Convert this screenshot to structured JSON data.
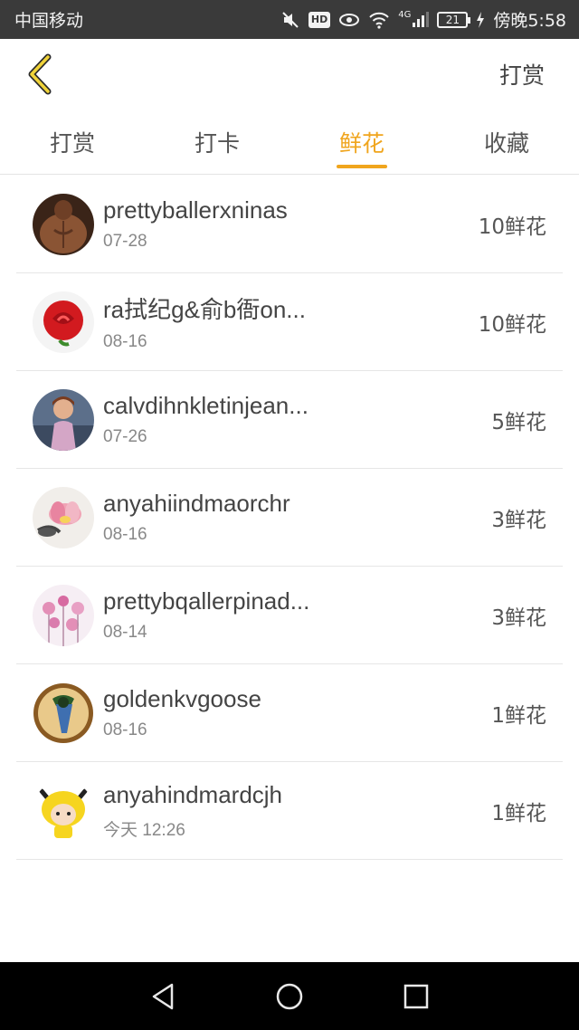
{
  "status_bar": {
    "carrier": "中国移动",
    "network": "4G",
    "battery": "21",
    "time": "傍晚5:58",
    "hd_badge": "HD"
  },
  "header": {
    "back_icon": "chevron-left-icon",
    "action_label": "打赏",
    "accent_color": "#f0a51d"
  },
  "tabs": [
    {
      "label": "打赏",
      "active": false
    },
    {
      "label": "打卡",
      "active": false
    },
    {
      "label": "鲜花",
      "active": true
    },
    {
      "label": "收藏",
      "active": false
    }
  ],
  "list": [
    {
      "name": "prettyballerxninas",
      "date": "07-28",
      "amount": "10鲜花"
    },
    {
      "name": "ra拭纪g&俞b衙on...",
      "date": "08-16",
      "amount": "10鲜花"
    },
    {
      "name": "calvdihnkletinjean...",
      "date": "07-26",
      "amount": "5鲜花"
    },
    {
      "name": "anyahiindmaorchr",
      "date": "08-16",
      "amount": "3鲜花"
    },
    {
      "name": "prettybqallerpinad...",
      "date": "08-14",
      "amount": "3鲜花"
    },
    {
      "name": "goldenkvgoose",
      "date": "08-16",
      "amount": "1鲜花"
    },
    {
      "name": "anyahindmardcjh",
      "date": "今天 12:26",
      "amount": "1鲜花"
    }
  ],
  "navbar": {
    "back": "triangle-back-icon",
    "home": "circle-home-icon",
    "recents": "square-recents-icon"
  }
}
